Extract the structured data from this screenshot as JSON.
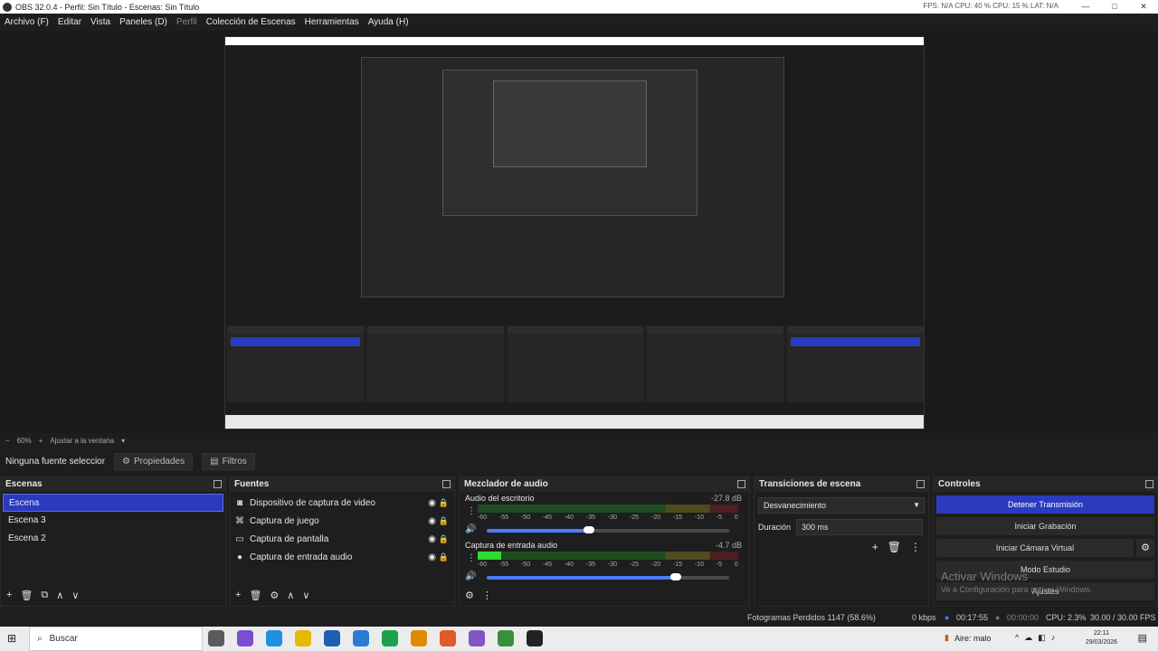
{
  "window": {
    "title": "OBS 32.0.4 - Perfil: Sin Título - Escenas: Sin Título",
    "stats_text": "FPS: N/A    CPU: 40 %    CPU: 15 %    LAT: N/A",
    "controls": [
      "—",
      "□",
      "✕"
    ]
  },
  "menu": {
    "items": [
      "Archivo (F)",
      "Editar",
      "Vista",
      "Paneles (D)",
      "Perfil",
      "Colección de Escenas",
      "Herramientas",
      "Ayuda (H)"
    ]
  },
  "zoom": {
    "minus": "−",
    "level": "60%",
    "plus": "+",
    "fit": "Ajustar a la ventana",
    "arrow": "▾"
  },
  "context": {
    "no_source": "Ninguna fuente seleccionada",
    "properties": "Propiedades",
    "filters": "Filtros"
  },
  "scenes": {
    "title": "Escenas",
    "items": [
      "Escena",
      "Escena 3",
      "Escena 2"
    ],
    "active_index": 0,
    "tools": [
      "+",
      "🗑",
      "⧉",
      "∧",
      "∨"
    ]
  },
  "sources": {
    "title": "Fuentes",
    "items": [
      {
        "icon": "camera-icon",
        "label": "Dispositivo de captura de video"
      },
      {
        "icon": "gamepad-icon",
        "label": "Captura de juego"
      },
      {
        "icon": "monitor-icon",
        "label": "Captura de pantalla"
      },
      {
        "icon": "microphone-icon",
        "label": "Captura de entrada audio"
      }
    ],
    "tools": [
      "+",
      "🗑",
      "⚙",
      "∧",
      "∨"
    ]
  },
  "mixer": {
    "title": "Mezclador de audio",
    "ticks": [
      "-60",
      "-55",
      "-50",
      "-45",
      "-40",
      "-35",
      "-30",
      "-25",
      "-20",
      "-15",
      "-10",
      "-5",
      "0"
    ],
    "channels": [
      {
        "name": "Audio del escritorio",
        "db": "-27.8 dB",
        "level": 0,
        "volume": 0.42
      },
      {
        "name": "Captura de entrada audio",
        "db": "-4.7 dB",
        "level": 0.09,
        "volume": 0.78
      }
    ],
    "tools": [
      "⚙",
      "⋮"
    ]
  },
  "transitions": {
    "title": "Transiciones de escena",
    "selected": "Desvanecimiento",
    "duration_label": "Duración",
    "duration_value": "300 ms",
    "tools": [
      "+",
      "🗑",
      "⋮"
    ]
  },
  "controls": {
    "title": "Controles",
    "stop_stream": "Detener Transmisión",
    "start_recording": "Iniciar Grabación",
    "start_virtual_cam": "Iniciar Cámara Virtual",
    "studio_mode": "Modo Estudio",
    "settings": "Ajustes",
    "watermark_title": "Activar Windows",
    "watermark_sub": "Ve a Configuración para activar Windows."
  },
  "status": {
    "dropped": "Fotogramas Perdidos 1147 (58.6%)",
    "kbps": "0 kbps",
    "stream_time": "00:17:55",
    "rec_time": "00:00:00",
    "cpu": "CPU: 2.3%",
    "fps": "30.00 / 30.00 FPS"
  },
  "taskbar": {
    "search": "Buscar",
    "weather": "Aire: malo",
    "time": "22:11",
    "date": "29/03/2026",
    "app_colors": [
      "#5b5b5b",
      "#7a4dd1",
      "#1f8fe0",
      "#e6b800",
      "#1e5fb3",
      "#2a7bd1",
      "#1aa34a",
      "#e08a00",
      "#e05a2a",
      "#7e57c2",
      "#3a8f3a",
      "#222222"
    ]
  }
}
